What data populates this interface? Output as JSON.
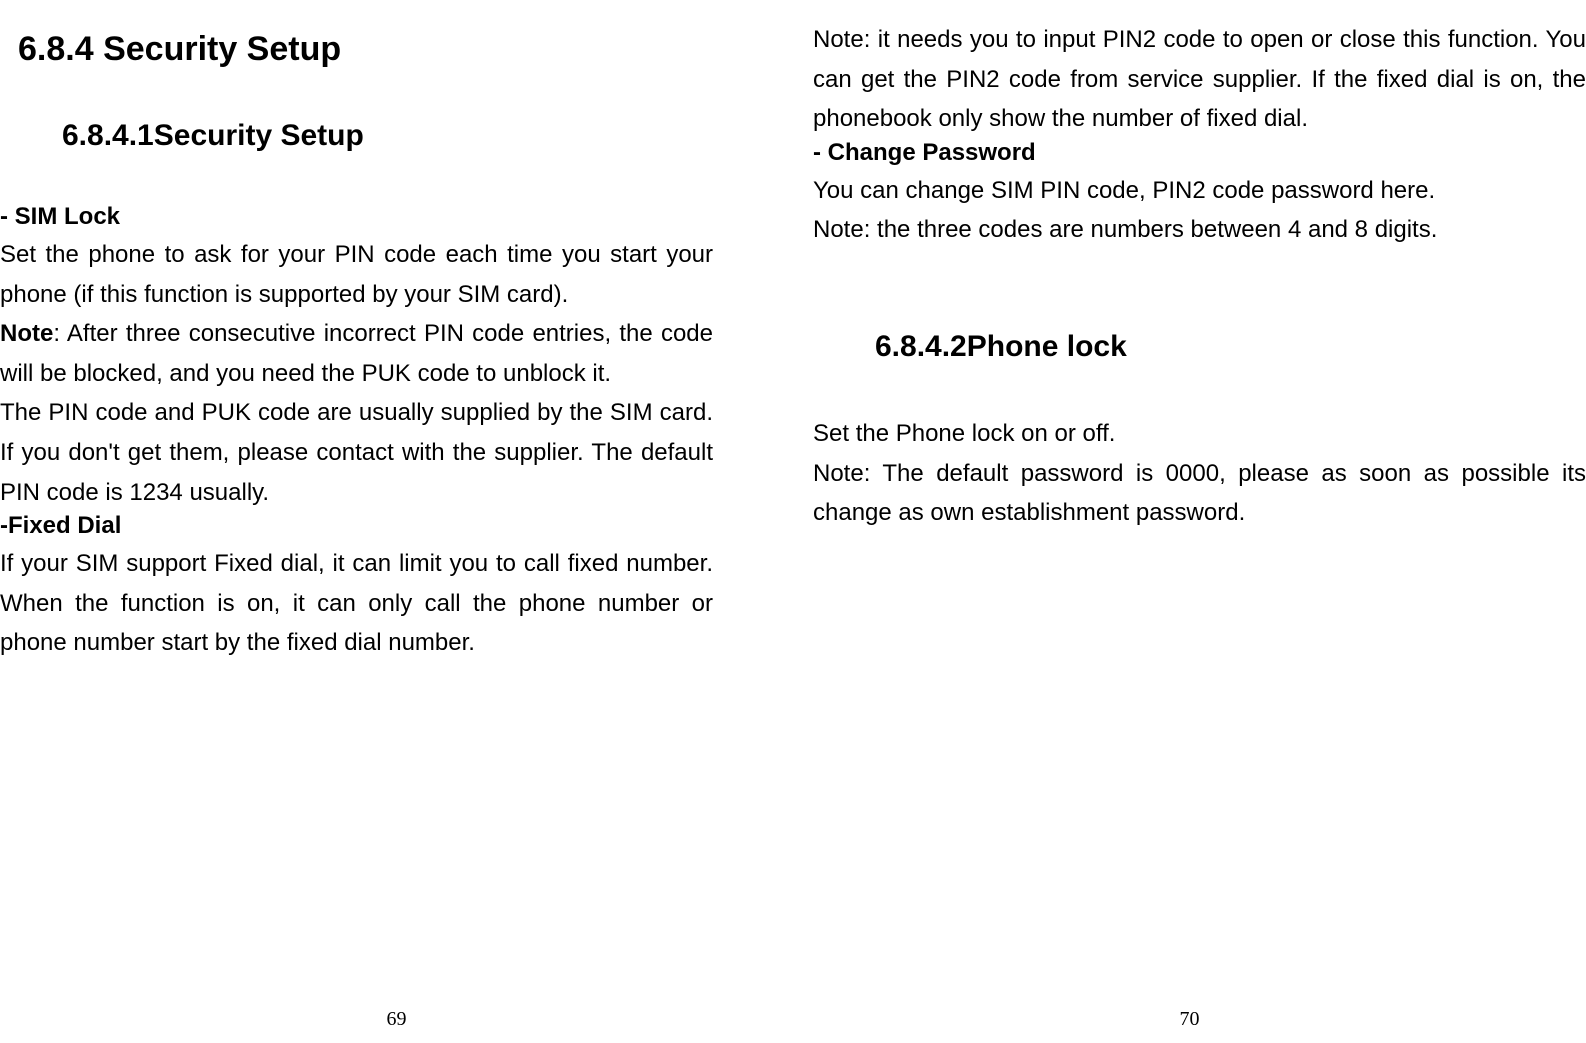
{
  "leftPage": {
    "heading1": "6.8.4  Security Setup",
    "heading2": "6.8.4.1Security Setup",
    "simLock": {
      "title": "- SIM Lock",
      "para1": "Set the phone to ask for your PIN code each time you start your phone (if this function is supported by your SIM card).",
      "notePrefix": "Note",
      "noteText": ": After three consecutive incorrect PIN code entries, the code will be blocked, and you need the PUK code to unblock it.",
      "para2": "The PIN code and PUK code are usually supplied by the SIM card. If you don't get them, please contact with the supplier. The default PIN code is 1234 usually."
    },
    "fixedDial": {
      "title": "-Fixed Dial",
      "para1": "If your SIM support Fixed dial, it can limit you to call fixed number. When the function is on, it can only call the phone number or phone number start by the fixed dial number."
    },
    "pageNumber": "69"
  },
  "rightPage": {
    "fixedDialNote": "Note: it needs you to input PIN2 code to open or close this function. You can get the PIN2 code from service supplier. If the fixed dial is on, the phonebook only show the number of fixed dial.",
    "changePassword": {
      "title": "- Change Password",
      "para1": "You can change SIM PIN code, PIN2 code password here.",
      "para2": "Note: the three codes are numbers between 4 and 8 digits."
    },
    "heading2": "6.8.4.2Phone lock",
    "phoneLock": {
      "para1": "Set the Phone lock on or off.",
      "para2": "Note: The default password is 0000, please as soon as possible its change as own establishment password."
    },
    "pageNumber": "70"
  }
}
